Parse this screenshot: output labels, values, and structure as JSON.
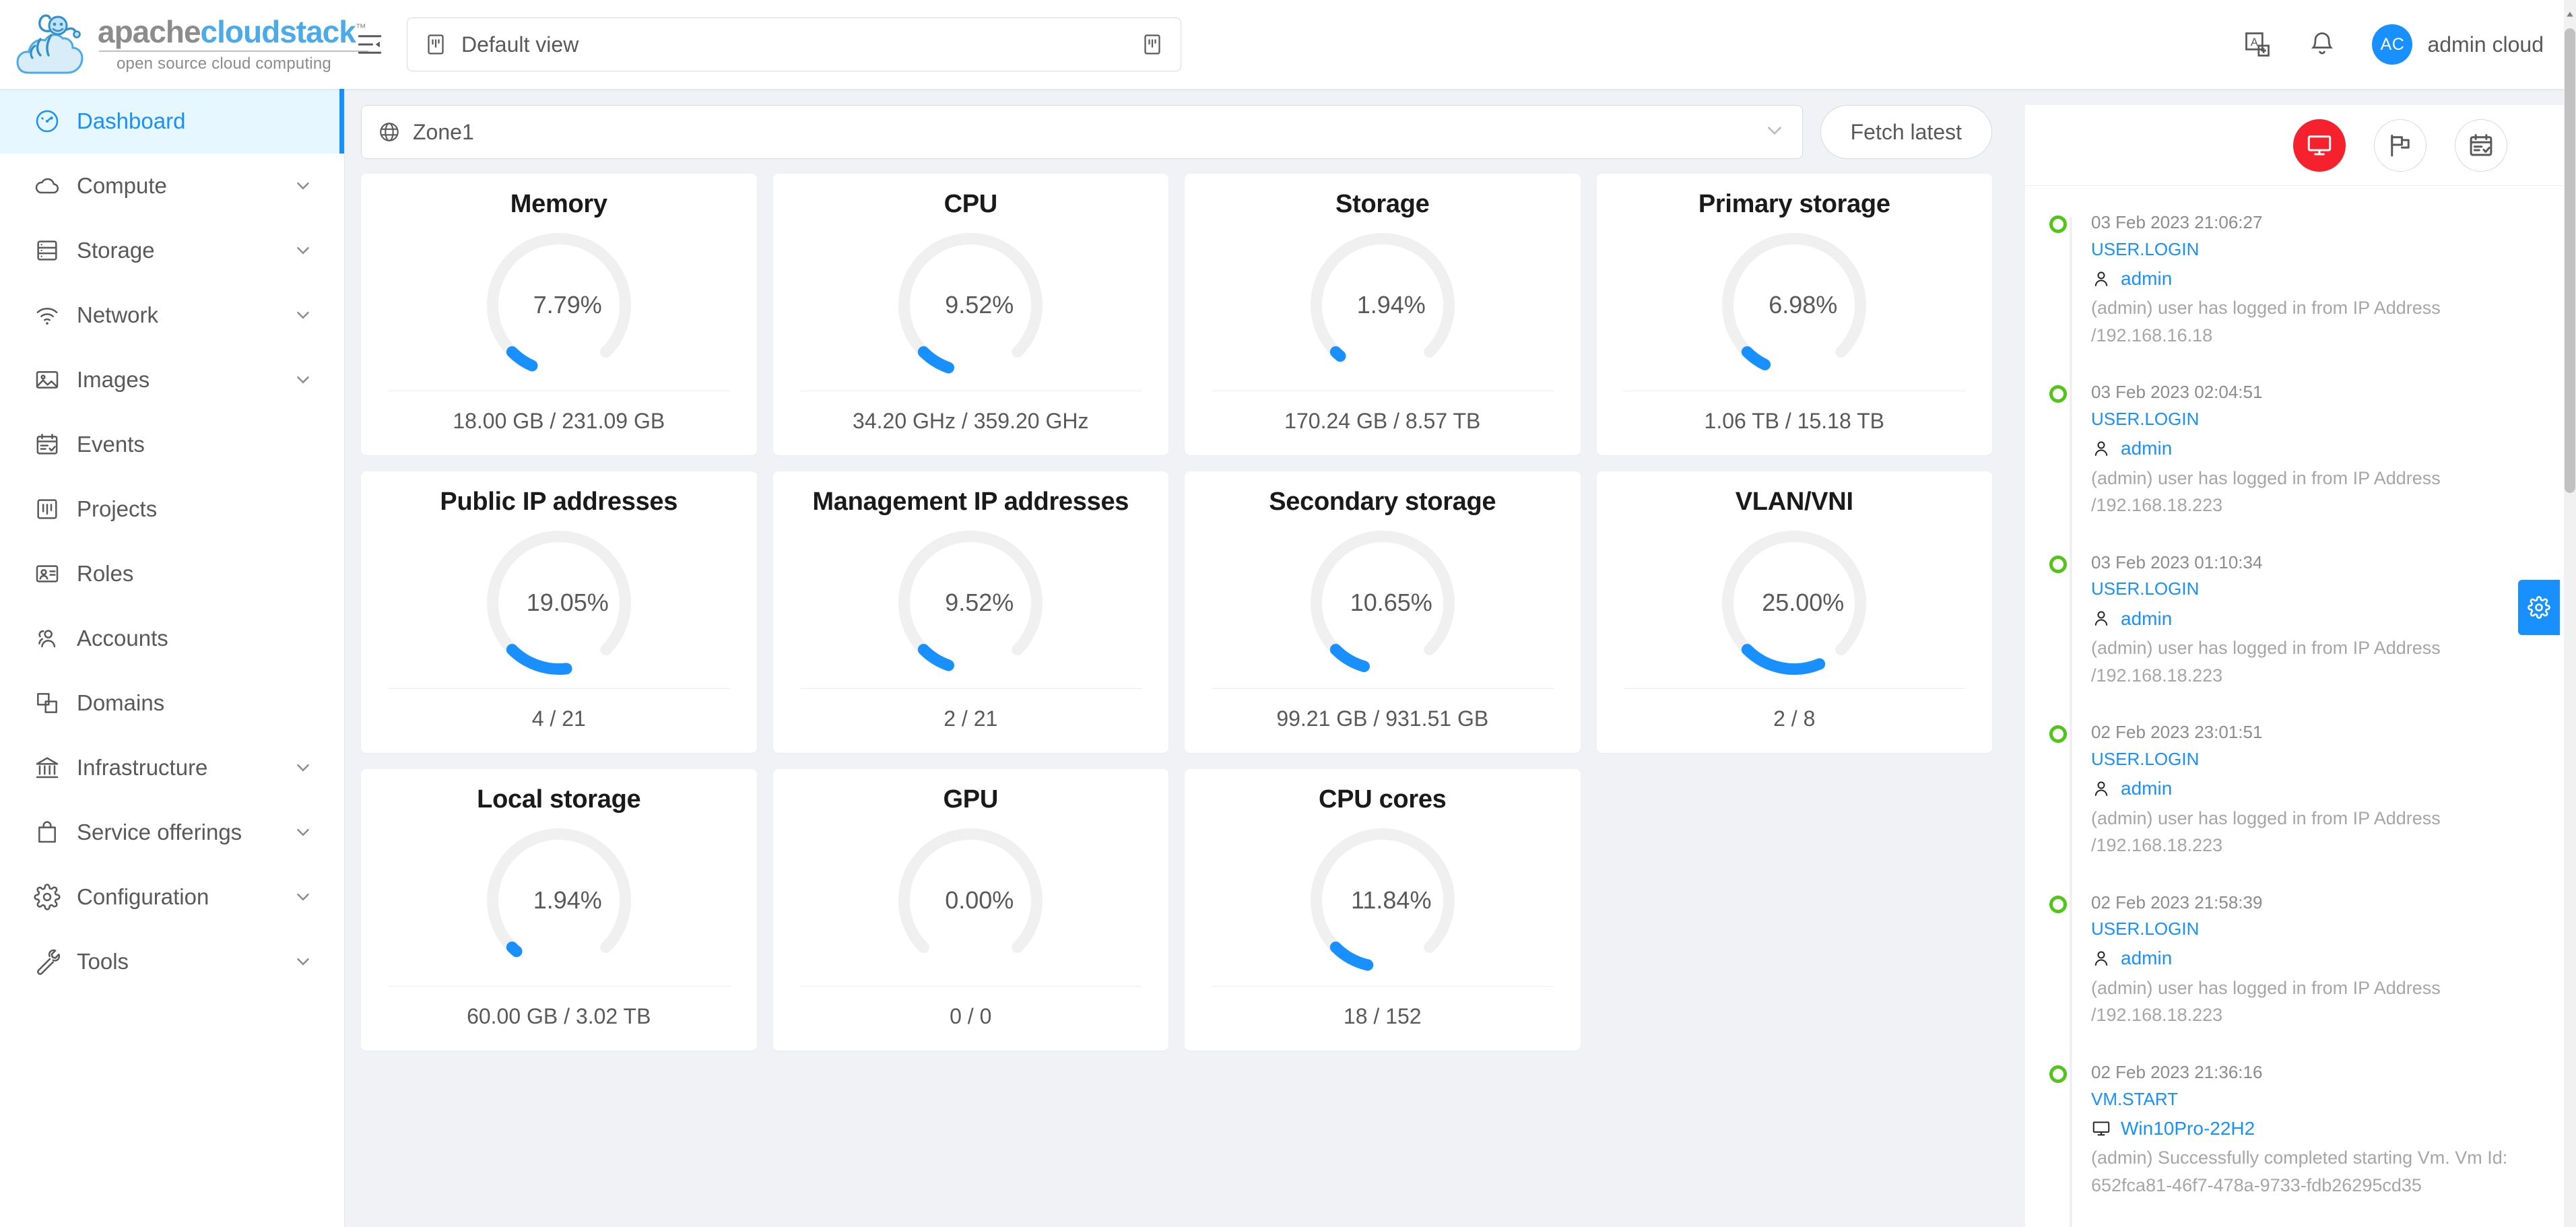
{
  "header": {
    "logo_word_part1": "apache",
    "logo_word_part2": "cloudstack",
    "logo_tm": "™",
    "logo_subtitle": "open source cloud computing",
    "collapse_icon": "menu-fold-icon",
    "search_value": "Default view",
    "search_left_icon": "project-view-icon",
    "search_right_icon": "project-view-icon",
    "language_icon": "translation-icon",
    "notification_icon": "bell-icon",
    "avatar_initials": "AC",
    "user_name": "admin cloud"
  },
  "sidebar": {
    "items": [
      {
        "label": "Dashboard",
        "icon": "dashboard-icon",
        "active": true,
        "expandable": false
      },
      {
        "label": "Compute",
        "icon": "cloud-icon",
        "active": false,
        "expandable": true
      },
      {
        "label": "Storage",
        "icon": "database-icon",
        "active": false,
        "expandable": true
      },
      {
        "label": "Network",
        "icon": "wifi-icon",
        "active": false,
        "expandable": true
      },
      {
        "label": "Images",
        "icon": "picture-icon",
        "active": false,
        "expandable": true
      },
      {
        "label": "Events",
        "icon": "calendar-check-icon",
        "active": false,
        "expandable": false
      },
      {
        "label": "Projects",
        "icon": "project-icon",
        "active": false,
        "expandable": false
      },
      {
        "label": "Roles",
        "icon": "id-card-icon",
        "active": false,
        "expandable": false
      },
      {
        "label": "Accounts",
        "icon": "team-icon",
        "active": false,
        "expandable": false
      },
      {
        "label": "Domains",
        "icon": "block-icon",
        "active": false,
        "expandable": false
      },
      {
        "label": "Infrastructure",
        "icon": "bank-icon",
        "active": false,
        "expandable": true
      },
      {
        "label": "Service offerings",
        "icon": "shopping-icon",
        "active": false,
        "expandable": true
      },
      {
        "label": "Configuration",
        "icon": "setting-icon",
        "active": false,
        "expandable": true
      },
      {
        "label": "Tools",
        "icon": "tool-icon",
        "active": false,
        "expandable": true
      }
    ]
  },
  "toolbar": {
    "zone_icon": "global-icon",
    "zone_value": "Zone1",
    "zone_caret": "chevron-down-icon",
    "fetch_label": "Fetch latest"
  },
  "chart_data": {
    "type": "gauge-grid",
    "title": "Zone1 capacity dashboard",
    "gauge_style": {
      "arc_degrees": 270,
      "gap_position": "bottom",
      "stroke_color": "#1890ff",
      "track_color": "#f0f0f0"
    },
    "cards": [
      {
        "title": "Memory",
        "percent": 7.79,
        "percent_label": "7.79%",
        "footer": "18.00 GB / 231.09 GB",
        "used": "18.00 GB",
        "total": "231.09 GB"
      },
      {
        "title": "CPU",
        "percent": 9.52,
        "percent_label": "9.52%",
        "footer": "34.20 GHz / 359.20 GHz",
        "used": "34.20 GHz",
        "total": "359.20 GHz"
      },
      {
        "title": "Storage",
        "percent": 1.94,
        "percent_label": "1.94%",
        "footer": "170.24 GB / 8.57 TB",
        "used": "170.24 GB",
        "total": "8.57 TB"
      },
      {
        "title": "Primary storage",
        "percent": 6.98,
        "percent_label": "6.98%",
        "footer": "1.06 TB / 15.18 TB",
        "used": "1.06 TB",
        "total": "15.18 TB"
      },
      {
        "title": "Public IP addresses",
        "percent": 19.05,
        "percent_label": "19.05%",
        "footer": "4 / 21",
        "used": "4",
        "total": "21"
      },
      {
        "title": "Management IP addresses",
        "percent": 9.52,
        "percent_label": "9.52%",
        "footer": "2 / 21",
        "used": "2",
        "total": "21"
      },
      {
        "title": "Secondary storage",
        "percent": 10.65,
        "percent_label": "10.65%",
        "footer": "99.21 GB / 931.51 GB",
        "used": "99.21 GB",
        "total": "931.51 GB"
      },
      {
        "title": "VLAN/VNI",
        "percent": 25.0,
        "percent_label": "25.00%",
        "footer": "2 / 8",
        "used": "2",
        "total": "8"
      },
      {
        "title": "Local storage",
        "percent": 1.94,
        "percent_label": "1.94%",
        "footer": "60.00 GB / 3.02 TB",
        "used": "60.00 GB",
        "total": "3.02 TB"
      },
      {
        "title": "GPU",
        "percent": 0.0,
        "percent_label": "0.00%",
        "footer": "0 / 0",
        "used": "0",
        "total": "0"
      },
      {
        "title": "CPU cores",
        "percent": 11.84,
        "percent_label": "11.84%",
        "footer": "18 / 152",
        "used": "18",
        "total": "152"
      }
    ]
  },
  "events": {
    "tabs": [
      {
        "icon": "desktop-icon",
        "active": true
      },
      {
        "icon": "flag-icon",
        "active": false
      },
      {
        "icon": "calendar-check-icon",
        "active": false
      }
    ],
    "items": [
      {
        "time": "03 Feb 2023 21:06:27",
        "type": "USER.LOGIN",
        "subject_icon": "user-icon",
        "subject": "admin",
        "description": "(admin) user has logged in from IP Address /192.168.16.18"
      },
      {
        "time": "03 Feb 2023 02:04:51",
        "type": "USER.LOGIN",
        "subject_icon": "user-icon",
        "subject": "admin",
        "description": "(admin) user has logged in from IP Address /192.168.18.223"
      },
      {
        "time": "03 Feb 2023 01:10:34",
        "type": "USER.LOGIN",
        "subject_icon": "user-icon",
        "subject": "admin",
        "description": "(admin) user has logged in from IP Address /192.168.18.223"
      },
      {
        "time": "02 Feb 2023 23:01:51",
        "type": "USER.LOGIN",
        "subject_icon": "user-icon",
        "subject": "admin",
        "description": "(admin) user has logged in from IP Address /192.168.18.223"
      },
      {
        "time": "02 Feb 2023 21:58:39",
        "type": "USER.LOGIN",
        "subject_icon": "user-icon",
        "subject": "admin",
        "description": "(admin) user has logged in from IP Address /192.168.18.223"
      },
      {
        "time": "02 Feb 2023 21:36:16",
        "type": "VM.START",
        "subject_icon": "desktop-icon",
        "subject": "Win10Pro-22H2",
        "description": "(admin) Successfully completed starting Vm. Vm Id: 652fca81-46f7-478a-9733-fdb26295cd35"
      }
    ]
  },
  "settings_tab": {
    "icon": "gear-icon"
  },
  "colors": {
    "accent": "#1890ff",
    "active_tab": "#f5222d",
    "event_dot": "#52c41a",
    "page_bg": "#f0f2f5",
    "gauge_track": "#f0f0f0"
  }
}
